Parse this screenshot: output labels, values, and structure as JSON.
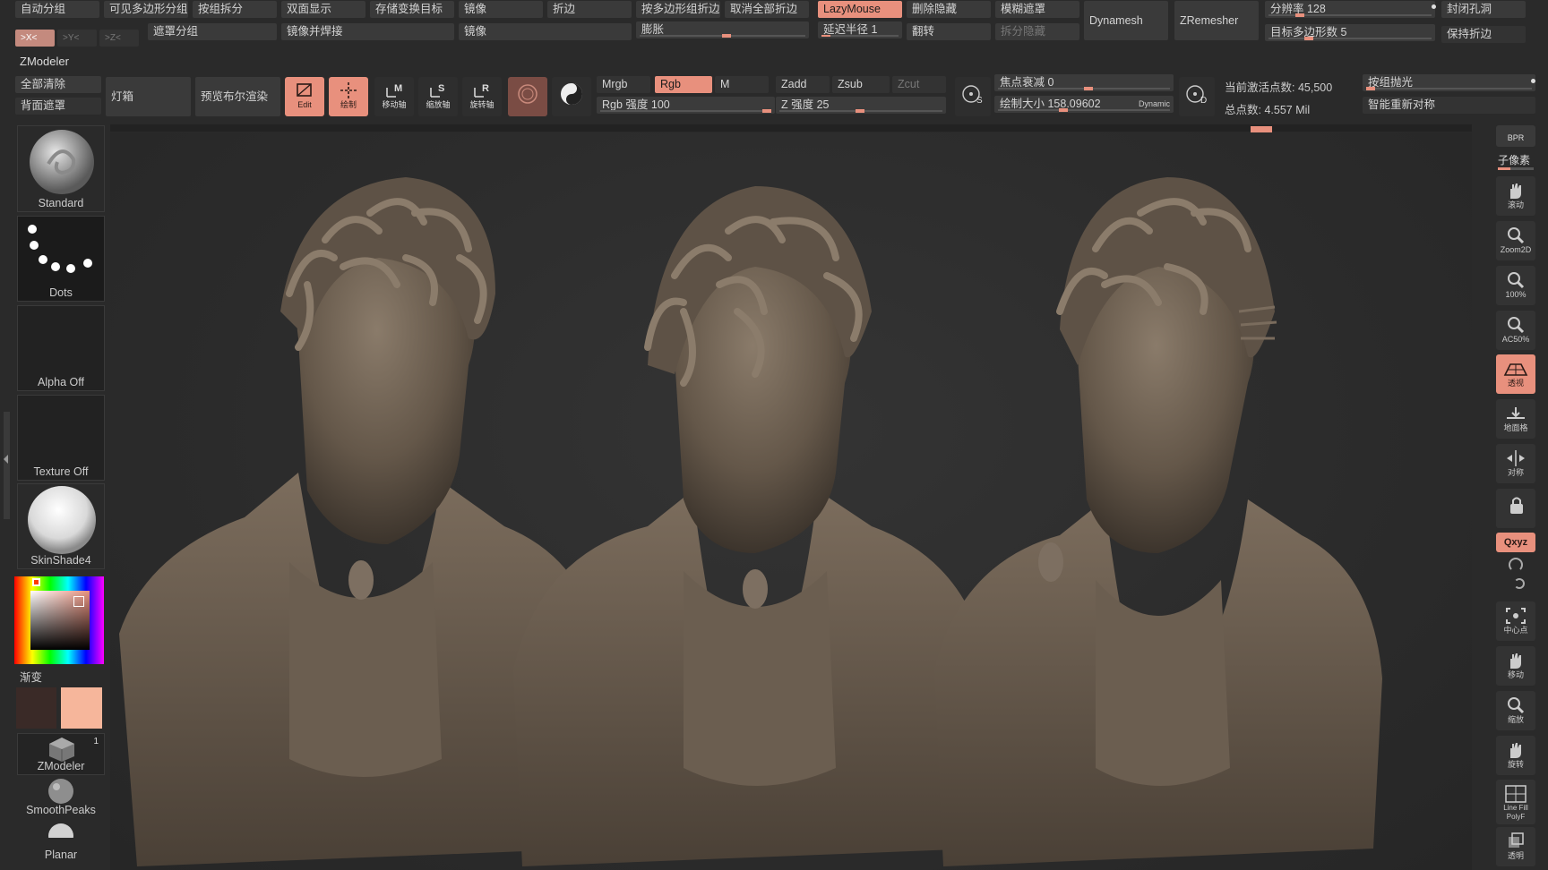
{
  "colors": {
    "accent": "#e8907d",
    "panel": "#3a3a3a",
    "bg": "#2a2a2a",
    "viewport": "#2c2c2c",
    "clay": "#6e6254"
  },
  "top_row1": [
    "自动分组",
    "可见多边形分组",
    "按组拆分",
    "双面显示",
    "存储变换目标",
    "镜像",
    "折边",
    "按多边形组折边",
    "取消全部折边",
    "LazyMouse",
    "删除隐藏",
    "模糊遮罩"
  ],
  "top_row2": [
    "遮罩分组",
    "镜像并焊接",
    "镜像",
    "膨胀",
    "延迟半径 1",
    "翻转",
    "拆分隐藏"
  ],
  "axis": {
    "x": ">X<",
    "y": ">Y<",
    "z": ">Z<"
  },
  "dynamesh": "Dynamesh",
  "zremesher": "ZRemesher",
  "resolution": "分辨率 128",
  "target_poly": "目标多边形数 5",
  "close_holes": "封闭孔洞",
  "keep_crease": "保持折边",
  "zmodeler_title": "ZModeler",
  "clear_all": "全部清除",
  "back_mask": "背面遮罩",
  "lightbox": "灯箱",
  "bpr_preview": "预览布尔渲染",
  "tool_icons": [
    {
      "label": "Edit",
      "letter": ""
    },
    {
      "label": "绘制",
      "letter": ""
    },
    {
      "label": "移动轴",
      "letter": "M"
    },
    {
      "label": "缩放轴",
      "letter": "S"
    },
    {
      "label": "旋转轴",
      "letter": "R"
    }
  ],
  "mrgb": "Mrgb",
  "rgb": "Rgb",
  "m": "M",
  "rgb_intensity": "Rgb 强度 100",
  "zadd": "Zadd",
  "zsub": "Zsub",
  "zcut": "Zcut",
  "z_intensity": "Z 强度 25",
  "focal_shift": "焦点衰减 0",
  "draw_size": "绘制大小 158.09602",
  "dynamic": "Dynamic",
  "s_letter": "S",
  "d_letter": "D",
  "active_points": "当前激活点数: 45,500",
  "total_points": "总点数: 4.557 Mil",
  "polish_by_group": "按组抛光",
  "smart_resym": "智能重新对称",
  "left_panel": {
    "brush": "Standard",
    "stroke": "Dots",
    "alpha": "Alpha Off",
    "texture": "Texture Off",
    "material": "SkinShade4",
    "gradient": "渐变",
    "zmodeler": "ZModeler",
    "zmodeler_count": "1",
    "smoothpeaks": "SmoothPeaks",
    "planar": "Planar"
  },
  "right_panel": {
    "bpr": "BPR",
    "subpixel": "子像素",
    "items": [
      "滚动",
      "Zoom2D",
      "100%",
      "AC50%",
      "透视",
      "地面格",
      "对称",
      "",
      "Qxyz",
      "中心点",
      "移动",
      "缩放",
      "旋转",
      "Line Fill PolyF",
      "透明"
    ]
  }
}
